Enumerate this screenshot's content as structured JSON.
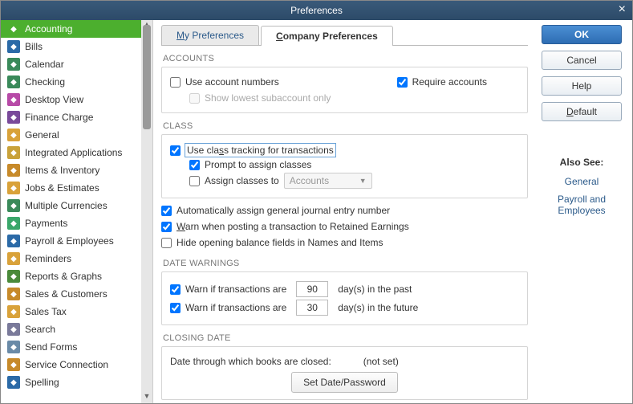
{
  "window": {
    "title": "Preferences"
  },
  "sidebar": {
    "selected": 0,
    "items": [
      {
        "label": "Accounting",
        "color": "#4caf2e"
      },
      {
        "label": "Bills",
        "color": "#2b6aa7"
      },
      {
        "label": "Calendar",
        "color": "#3a8a5a"
      },
      {
        "label": "Checking",
        "color": "#3a8a5a"
      },
      {
        "label": "Desktop View",
        "color": "#b74aa7"
      },
      {
        "label": "Finance Charge",
        "color": "#7a4a9a"
      },
      {
        "label": "General",
        "color": "#d9a23a"
      },
      {
        "label": "Integrated Applications",
        "color": "#c9a23a"
      },
      {
        "label": "Items & Inventory",
        "color": "#c78a2a"
      },
      {
        "label": "Jobs & Estimates",
        "color": "#d9a23a"
      },
      {
        "label": "Multiple Currencies",
        "color": "#3a8a5a"
      },
      {
        "label": "Payments",
        "color": "#3aa76a"
      },
      {
        "label": "Payroll & Employees",
        "color": "#2b6aa7"
      },
      {
        "label": "Reminders",
        "color": "#d9a23a"
      },
      {
        "label": "Reports & Graphs",
        "color": "#4a8a3a"
      },
      {
        "label": "Sales & Customers",
        "color": "#c78a2a"
      },
      {
        "label": "Sales Tax",
        "color": "#d9a23a"
      },
      {
        "label": "Search",
        "color": "#7a7a9a"
      },
      {
        "label": "Send Forms",
        "color": "#6a8aa7"
      },
      {
        "label": "Service Connection",
        "color": "#c78a2a"
      },
      {
        "label": "Spelling",
        "color": "#2b6aa7"
      }
    ]
  },
  "tabs": {
    "my": "y Preferences",
    "company": "ompany Preferences"
  },
  "sections": {
    "accounts": "ACCOUNTS",
    "class": "CLASS",
    "date_warnings": "DATE WARNINGS",
    "closing": "CLOSING DATE"
  },
  "accounts": {
    "use_numbers": "Use account numbers",
    "require": "Require accounts",
    "show_lowest": "Show lowest subaccount only"
  },
  "class": {
    "use_tracking_pre": "Use cla",
    "use_tracking_post": "s tracking for transactions",
    "prompt": "Prompt to assign classes",
    "assign_to": "Assign classes to",
    "assign_to_value": "Accounts"
  },
  "misc": {
    "auto_journal": "Automatically assign general journal entry number",
    "warn_retained": "arn when posting a transaction to Retained Earnings",
    "hide_opening": "Hide opening balance fields in Names and Items"
  },
  "date_warnings": {
    "prefix": "Warn if transactions are",
    "past_days": "90",
    "past_suffix": "day(s) in the past",
    "future_days": "30",
    "future_suffix": "day(s) in the future"
  },
  "closing": {
    "text": "Date through which books are closed:",
    "value": "(not set)",
    "button": "Set Date/Password"
  },
  "buttons": {
    "ok": "OK",
    "cancel": "Cancel",
    "help": "Help",
    "default": "efault"
  },
  "also_see": {
    "heading": "Also See:",
    "links": [
      "General",
      "Payroll and Employees"
    ]
  }
}
